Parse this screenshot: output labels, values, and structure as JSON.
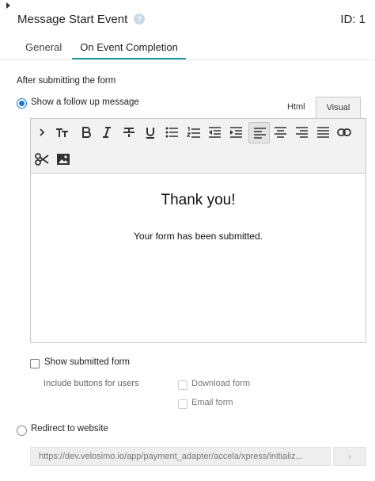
{
  "header": {
    "title": "Message Start Event",
    "id_label": "ID: 1"
  },
  "tabs": [
    {
      "label": "General",
      "active": false
    },
    {
      "label": "On Event Completion",
      "active": true
    }
  ],
  "form": {
    "section_title": "After submitting the form",
    "option_message": {
      "label": "Show a follow up message",
      "selected": true
    },
    "option_redirect": {
      "label": "Redirect to website",
      "selected": false
    },
    "show_submitted": {
      "label": "Show submitted form",
      "checked": false
    },
    "include_buttons_label": "Include buttons for users",
    "download_form": {
      "label": "Download form",
      "checked": false
    },
    "email_form": {
      "label": "Email form",
      "checked": false
    },
    "redirect_url": "https://dev.velosimo.io/app/payment_adapter/accela/xpress/initializ..."
  },
  "editor": {
    "tabs": [
      {
        "label": "Html",
        "active": false
      },
      {
        "label": "Visual",
        "active": true
      }
    ],
    "toolbar": [
      "chevron-right-icon",
      "text-size-icon",
      "bold-icon",
      "italic-icon",
      "strikethrough-icon",
      "underline-icon",
      "bulleted-list-icon",
      "numbered-list-icon",
      "outdent-icon",
      "indent-icon",
      "align-left-icon",
      "align-center-icon",
      "align-right-icon",
      "align-justify-icon",
      "link-icon",
      "scissors-icon",
      "image-icon"
    ],
    "content_heading": "Thank you!",
    "content_body": "Your form has been submitted."
  },
  "colors": {
    "accent": "#1b9aa0",
    "radio": "#1f78d1"
  },
  "url_button_glyph": "›"
}
